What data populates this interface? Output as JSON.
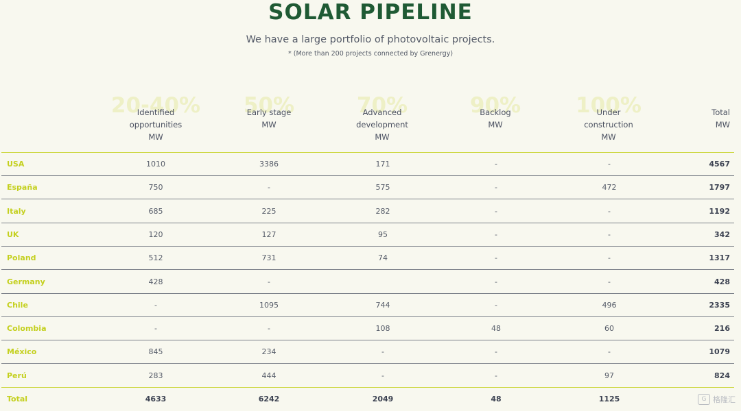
{
  "title": "SOLAR PIPELINE",
  "subtitle": "We have a large portfolio of photovoltaic projects.",
  "footnote": "* (More than 200 projects connected by Grenergy)",
  "colors": {
    "title": "#1f5a34",
    "country": "#c4d01e",
    "accent_rule": "#c9d42f",
    "background": "#f8f8ef"
  },
  "columns": [
    {
      "label": "Identified\nopportunities\nMW",
      "probability": "20-40%"
    },
    {
      "label": "Early stage\nMW",
      "probability": "50%"
    },
    {
      "label": "Advanced\ndevelopment\nMW",
      "probability": "70%"
    },
    {
      "label": "Backlog\nMW",
      "probability": "90%"
    },
    {
      "label": "Under\nconstruction\nMW",
      "probability": "100%"
    },
    {
      "label": "Total\nMW",
      "probability": ""
    }
  ],
  "rows": [
    {
      "country": "USA",
      "values": [
        "1010",
        "3386",
        "171",
        "-",
        "-",
        "4567"
      ]
    },
    {
      "country": "España",
      "values": [
        "750",
        "-",
        "575",
        "-",
        "472",
        "1797"
      ]
    },
    {
      "country": "Italy",
      "values": [
        "685",
        "225",
        "282",
        "-",
        "-",
        "1192"
      ]
    },
    {
      "country": "UK",
      "values": [
        "120",
        "127",
        "95",
        "-",
        "-",
        "342"
      ]
    },
    {
      "country": "Poland",
      "values": [
        "512",
        "731",
        "74",
        "-",
        "-",
        "1317"
      ]
    },
    {
      "country": "Germany",
      "values": [
        "428",
        "-",
        "",
        "-",
        "-",
        "428"
      ]
    },
    {
      "country": "Chile",
      "values": [
        "-",
        "1095",
        "744",
        "-",
        "496",
        "2335"
      ]
    },
    {
      "country": "Colombia",
      "values": [
        "-",
        "-",
        "108",
        "48",
        "60",
        "216"
      ]
    },
    {
      "country": "México",
      "values": [
        "845",
        "234",
        "-",
        "-",
        "-",
        "1079"
      ]
    },
    {
      "country": "Perú",
      "values": [
        "283",
        "444",
        "-",
        "-",
        "97",
        "824"
      ]
    }
  ],
  "total": {
    "country": "Total",
    "values": [
      "4633",
      "6242",
      "2049",
      "48",
      "1125",
      ""
    ]
  },
  "watermark": {
    "icon": "gelonghui-logo-icon",
    "text": "格隆汇"
  }
}
